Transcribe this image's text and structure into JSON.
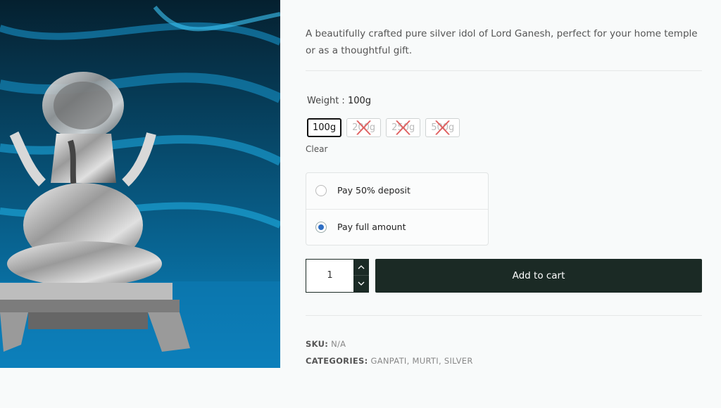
{
  "product": {
    "image_alt": "Silver Lord Ganesh idol on blue silk background",
    "description": "A beautifully crafted pure silver idol of Lord Ganesh, perfect for your home temple or as a thoughtful gift."
  },
  "variations": {
    "label": "Weight :",
    "selected_value": "100g",
    "options": [
      {
        "label": "100g",
        "available": true,
        "selected": true
      },
      {
        "label": "200g",
        "available": false,
        "selected": false
      },
      {
        "label": "250g",
        "available": false,
        "selected": false
      },
      {
        "label": "500g",
        "available": false,
        "selected": false
      }
    ],
    "clear_label": "Clear"
  },
  "payment": {
    "options": [
      {
        "label": "Pay 50% deposit",
        "checked": false
      },
      {
        "label": "Pay full amount",
        "checked": true
      }
    ]
  },
  "cart": {
    "quantity": "1",
    "add_label": "Add to cart"
  },
  "meta": {
    "sku_label": "SKU:",
    "sku_value": "N/A",
    "categories_label": "CATEGORIES:",
    "categories": [
      "GANPATI",
      "MURTI",
      "SILVER"
    ],
    "separator": ", "
  },
  "colors": {
    "button_bg": "#1b2a25",
    "radio_checked": "#2d6ec4",
    "background": "#f8fafa"
  }
}
